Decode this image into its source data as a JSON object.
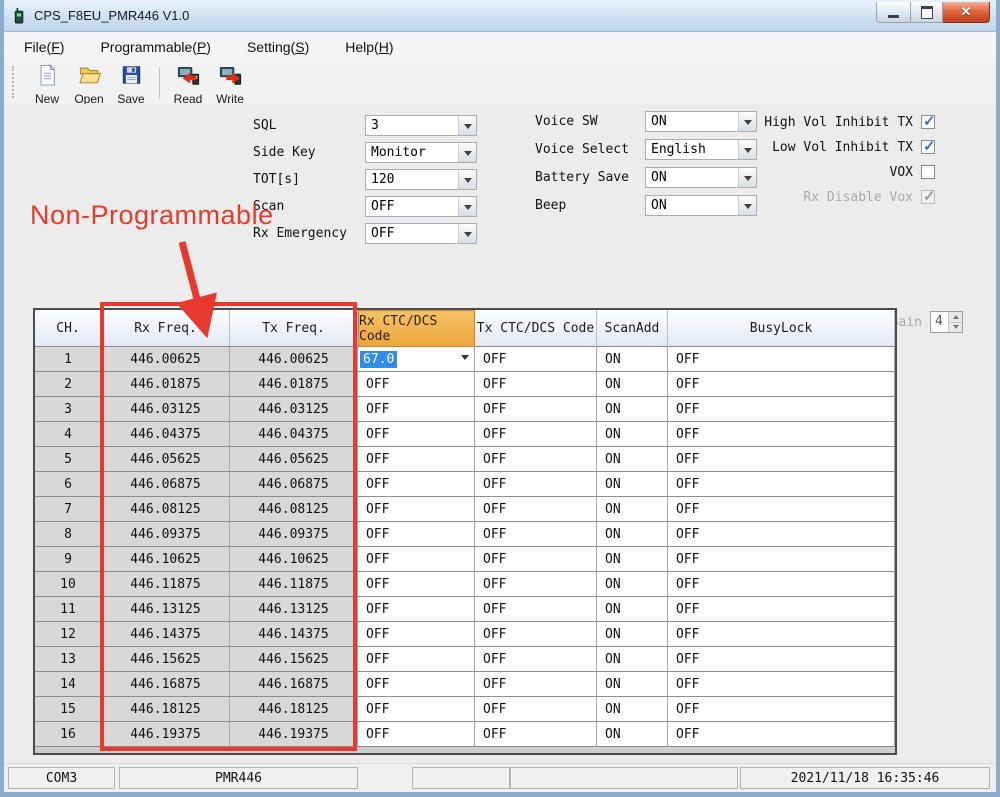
{
  "window": {
    "title": "CPS_F8EU_PMR446 V1.0"
  },
  "window_controls": {
    "minimize": "minimize",
    "maximize": "maximize",
    "close": "close"
  },
  "menu": {
    "items": [
      {
        "pre": "File(",
        "key": "F",
        "post": ")"
      },
      {
        "pre": "Programmable(",
        "key": "P",
        "post": ")"
      },
      {
        "pre": "Setting(",
        "key": "S",
        "post": ")"
      },
      {
        "pre": "Help(",
        "key": "H",
        "post": ")"
      }
    ]
  },
  "toolbar": {
    "buttons": [
      {
        "label": "New",
        "icon": "new-document-icon",
        "separator_before": false
      },
      {
        "label": "Open",
        "icon": "open-folder-icon",
        "separator_before": false
      },
      {
        "label": "Save",
        "icon": "save-floppy-icon",
        "separator_before": false
      },
      {
        "label": "Read",
        "icon": "read-from-radio-icon",
        "separator_before": true
      },
      {
        "label": "Write",
        "icon": "write-to-radio-icon",
        "separator_before": false
      }
    ]
  },
  "settings": {
    "left": [
      {
        "label": "SQL",
        "value": "3"
      },
      {
        "label": "Side Key",
        "value": "Monitor"
      },
      {
        "label": "TOT[s]",
        "value": "120"
      },
      {
        "label": "Scan",
        "value": "OFF"
      },
      {
        "label": "Rx Emergency",
        "value": "OFF"
      }
    ],
    "middle": [
      {
        "label": "Voice SW",
        "value": "ON"
      },
      {
        "label": "Voice Select",
        "value": "English"
      },
      {
        "label": "Battery Save",
        "value": "ON"
      },
      {
        "label": "Beep",
        "value": "ON"
      }
    ],
    "checkboxes": [
      {
        "label": "High Vol Inhibit TX",
        "checked": true,
        "disabled": false
      },
      {
        "label": "Low Vol Inhibit TX",
        "checked": true,
        "disabled": false
      },
      {
        "label": "VOX",
        "checked": false,
        "disabled": false
      },
      {
        "label": "Rx Disable Vox",
        "checked": true,
        "disabled": true
      }
    ],
    "vox_gain": {
      "label": "Vox Gain",
      "value": "4",
      "disabled": true
    }
  },
  "annotation": {
    "text": "Non-Programmable",
    "color": "#e8392e"
  },
  "table": {
    "headers": [
      "CH.",
      "Rx Freq.",
      "Tx Freq.",
      "Rx CTC/DCS Code",
      "Tx CTC/DCS Code",
      "ScanAdd",
      "BusyLock"
    ],
    "highlighted_header": "Rx CTC/DCS Code",
    "rows": [
      [
        "1",
        "446.00625",
        "446.00625",
        "67.0",
        "OFF",
        "ON",
        "OFF"
      ],
      [
        "2",
        "446.01875",
        "446.01875",
        "OFF",
        "OFF",
        "ON",
        "OFF"
      ],
      [
        "3",
        "446.03125",
        "446.03125",
        "OFF",
        "OFF",
        "ON",
        "OFF"
      ],
      [
        "4",
        "446.04375",
        "446.04375",
        "OFF",
        "OFF",
        "ON",
        "OFF"
      ],
      [
        "5",
        "446.05625",
        "446.05625",
        "OFF",
        "OFF",
        "ON",
        "OFF"
      ],
      [
        "6",
        "446.06875",
        "446.06875",
        "OFF",
        "OFF",
        "ON",
        "OFF"
      ],
      [
        "7",
        "446.08125",
        "446.08125",
        "OFF",
        "OFF",
        "ON",
        "OFF"
      ],
      [
        "8",
        "446.09375",
        "446.09375",
        "OFF",
        "OFF",
        "ON",
        "OFF"
      ],
      [
        "9",
        "446.10625",
        "446.10625",
        "OFF",
        "OFF",
        "ON",
        "OFF"
      ],
      [
        "10",
        "446.11875",
        "446.11875",
        "OFF",
        "OFF",
        "ON",
        "OFF"
      ],
      [
        "11",
        "446.13125",
        "446.13125",
        "OFF",
        "OFF",
        "ON",
        "OFF"
      ],
      [
        "12",
        "446.14375",
        "446.14375",
        "OFF",
        "OFF",
        "ON",
        "OFF"
      ],
      [
        "13",
        "446.15625",
        "446.15625",
        "OFF",
        "OFF",
        "ON",
        "OFF"
      ],
      [
        "14",
        "446.16875",
        "446.16875",
        "OFF",
        "OFF",
        "ON",
        "OFF"
      ],
      [
        "15",
        "446.18125",
        "446.18125",
        "OFF",
        "OFF",
        "ON",
        "OFF"
      ],
      [
        "16",
        "446.19375",
        "446.19375",
        "OFF",
        "OFF",
        "ON",
        "OFF"
      ]
    ],
    "row1_rx_code_selected": "67.0"
  },
  "statusbar": {
    "com_port": "COM3",
    "model": "PMR446",
    "datetime": "2021/11/18 16:35:46"
  },
  "colors": {
    "accent_red": "#e8392e",
    "header_orange": "#eda63c",
    "selection_blue": "#2f8ee8",
    "titlebar_blue": "#cfe1f1"
  }
}
